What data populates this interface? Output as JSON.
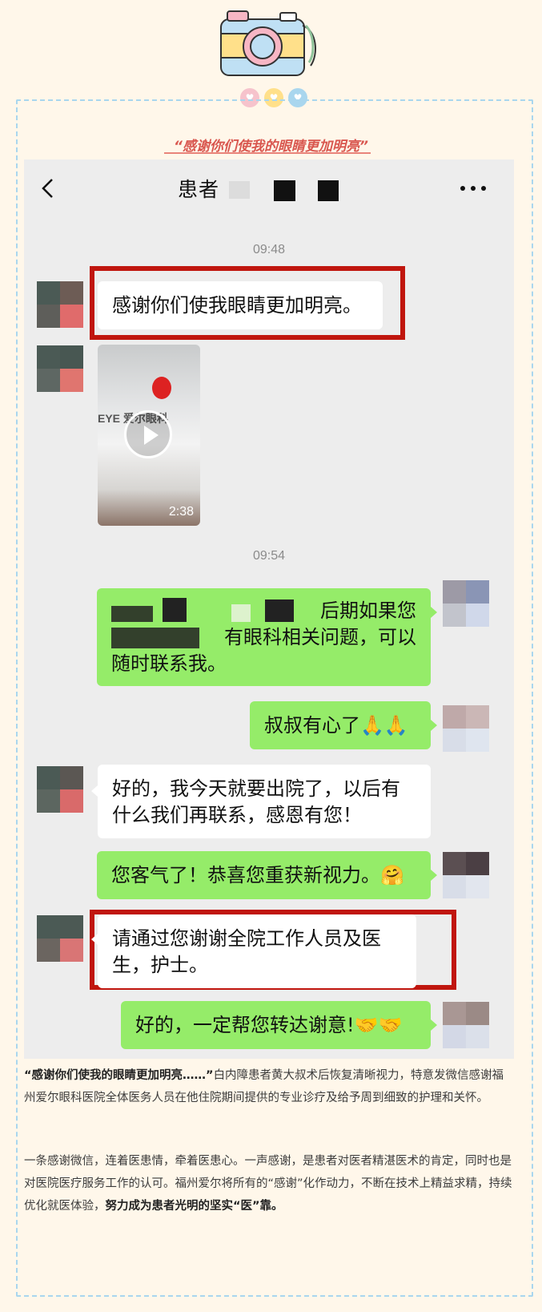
{
  "caption": {
    "title": "“感谢你们使我的眼睛更加明亮”"
  },
  "chat": {
    "header": {
      "title": "患者"
    },
    "messages": {
      "time_1": "09:48",
      "msg_1": "感谢你们使我眼睛更加明亮。",
      "video_duration": "2:38",
      "video_logo": "EYE 爱尔眼科",
      "time_2": "09:54",
      "msg_2_suffix": "后期如果您",
      "msg_2_line2": "有眼科相关问题，可以",
      "msg_2_line3": "随时联系我。",
      "msg_3": "叔叔有心了🙏🙏",
      "msg_4": "好的，我今天就要出院了，以后有什么我们再联系，感恩有您！",
      "msg_5": "您客气了！恭喜您重获新视力。🤗",
      "msg_6": "请通过您谢谢全院工作人员及医生，护士。",
      "msg_7": "好的，一定帮您转达谢意!🤝🤝"
    }
  },
  "article": {
    "p1_bold": "“感谢你们使我的眼睛更加明亮……”",
    "p1_rest": "白内障患者黄大叔术后恢复清晰视力，特意发微信感谢福州爱尔眼科医院全体医务人员在他住院期间提供的专业诊疗及给予周到细致的护理和关怀。",
    "p2_rest": "一条感谢微信，连着医患情，牵着医患心。一声感谢，是患者对医者精湛医术的肯定，同时也是对医院医疗服务工作的认可。福州爱尔将所有的“感谢”化作动力，不断在技术上精益求精，持续优化就医体验，",
    "p2_bold": "努力成为患者光明的坚实“医”靠。"
  },
  "colors": {
    "page_bg": "#fff7ea",
    "dash_border": "#a9d6ee",
    "accent_red": "#c0160e",
    "bubble_green": "#95ec69",
    "chat_bg": "#ededed"
  },
  "icons": [
    "camera-icon",
    "heart-icon",
    "back-arrow-icon",
    "more-dots-icon",
    "play-icon"
  ]
}
